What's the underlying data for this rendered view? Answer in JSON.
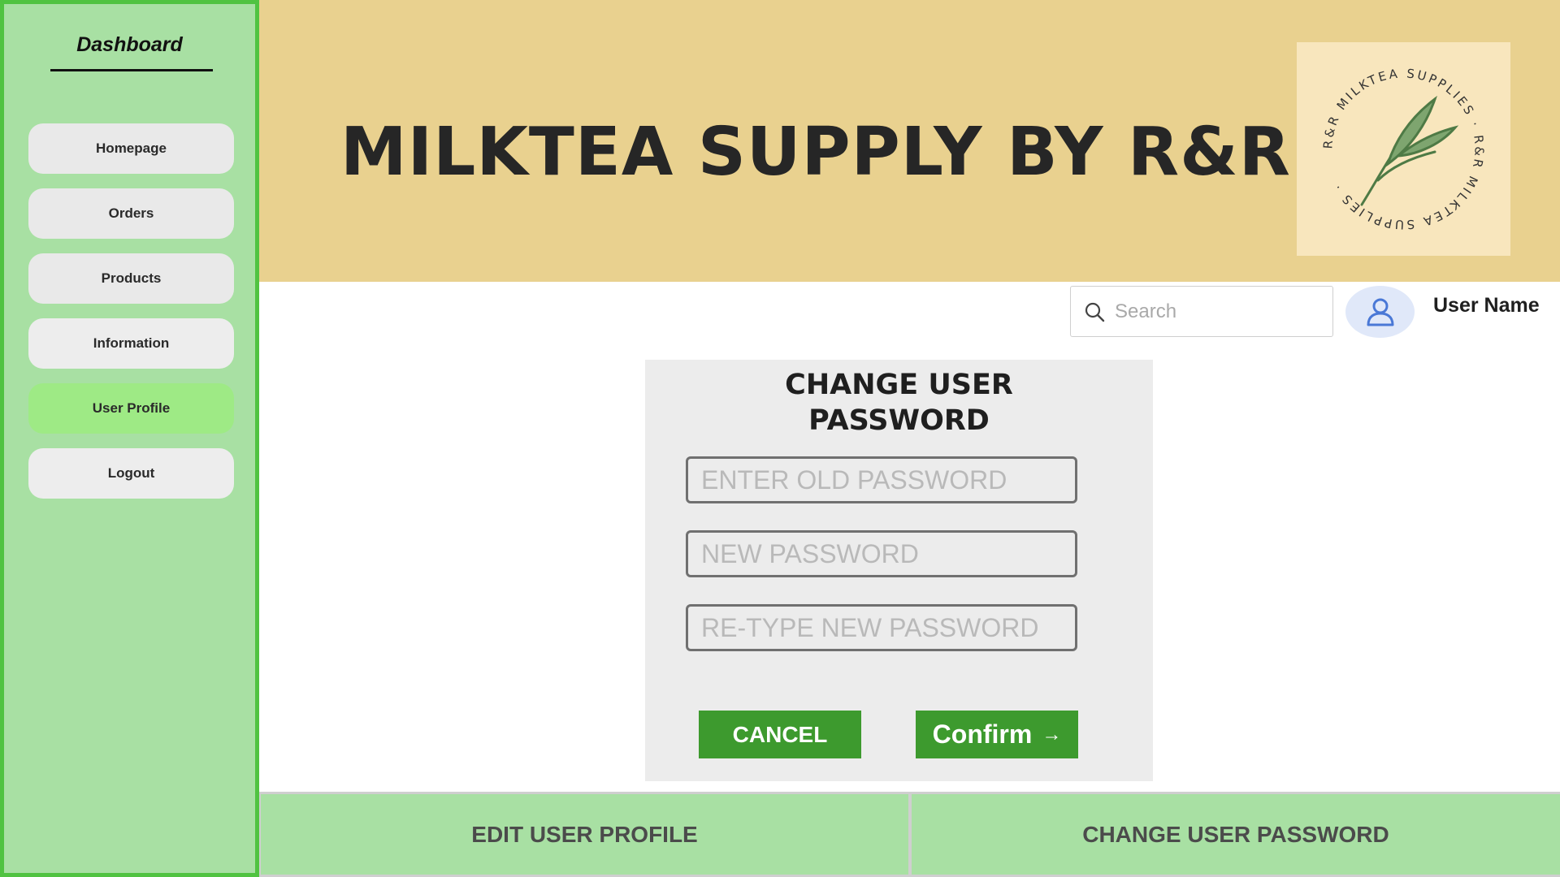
{
  "sidebar": {
    "title": "Dashboard",
    "items": [
      {
        "label": "Homepage"
      },
      {
        "label": "Orders"
      },
      {
        "label": "Products"
      },
      {
        "label": "Information"
      },
      {
        "label": "User Profile",
        "active": true
      },
      {
        "label": "Logout"
      }
    ]
  },
  "header": {
    "brand": "MILKTEA SUPPLY BY R&R",
    "logo": {
      "ring_text": "R&R MILKTEA SUPPLIES · R&R MILKTEA SUPPLIES ·",
      "icon": "leaf-icon"
    }
  },
  "topbar": {
    "search": {
      "placeholder": "Search",
      "value": "",
      "icon": "search-icon"
    },
    "avatar_icon": "user-icon",
    "user_name": "User Name"
  },
  "password_form": {
    "title_line1": "CHANGE USER",
    "title_line2": "PASSWORD",
    "fields": [
      {
        "placeholder": "ENTER OLD PASSWORD",
        "value": ""
      },
      {
        "placeholder": "NEW PASSWORD",
        "value": ""
      },
      {
        "placeholder": "RE-TYPE NEW PASSWORD",
        "value": ""
      }
    ],
    "cancel_label": "CANCEL",
    "confirm_label": "Confirm",
    "confirm_arrow": "→"
  },
  "tabs": {
    "edit_profile": "EDIT USER PROFILE",
    "change_password": "CHANGE USER PASSWORD"
  },
  "colors": {
    "sidebar_bg": "#a8e0a3",
    "sidebar_border": "#50c341",
    "header_bg": "#e9d18f",
    "active_nav": "#9eea85",
    "button_green": "#3d9a2e",
    "panel_bg": "#ececec"
  }
}
